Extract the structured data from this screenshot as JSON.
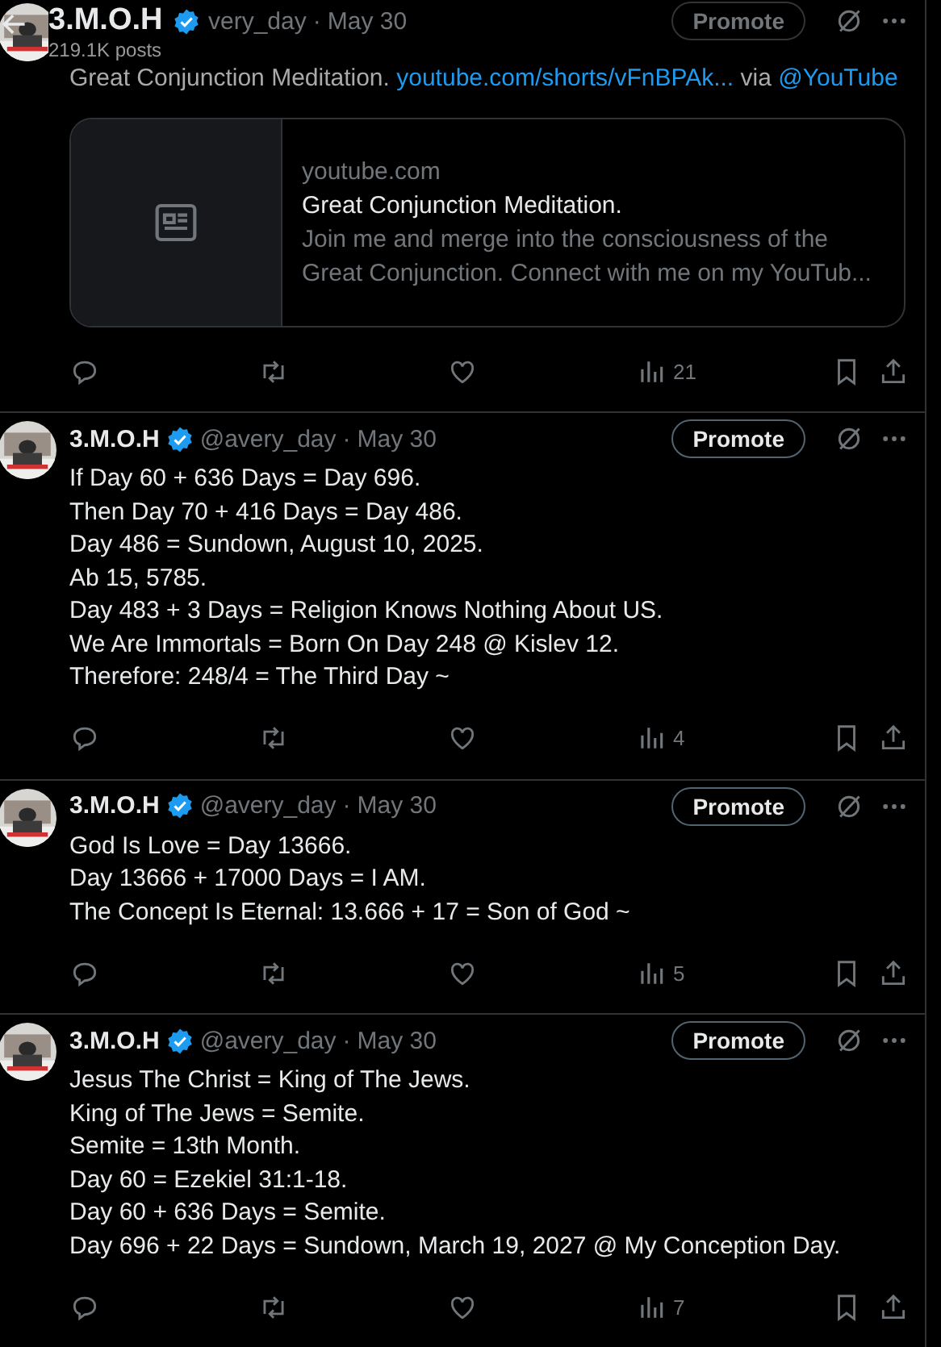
{
  "header": {
    "title": "3.M.O.H",
    "verified": true,
    "subtitle": "219.1K posts"
  },
  "posts": [
    {
      "verified": false,
      "handle": "very_day",
      "separator": "·",
      "date": "May 30",
      "promote": "Promote",
      "parts": [
        {
          "kind": "text",
          "text": "Great Conjunction Meditation. "
        },
        {
          "kind": "link",
          "text": "youtube.com/shorts/vFnBPAk..."
        },
        {
          "kind": "text",
          "text": " via "
        },
        {
          "kind": "link",
          "text": "@YouTube"
        }
      ],
      "card": {
        "domain": "youtube.com",
        "title": "Great Conjunction Meditation.",
        "description": "Join me and merge into the consciousness of the Great Conjunction. Connect with me on my YouTub..."
      },
      "views": "21"
    },
    {
      "name": "3.M.O.H",
      "verified": true,
      "handle": "@avery_day",
      "separator": "·",
      "date": "May 30",
      "promote": "Promote",
      "lines": [
        "If Day 60 + 636 Days = Day 696.",
        "Then Day 70 + 416 Days = Day 486.",
        "Day 486 = Sundown, August 10, 2025.",
        "Ab 15, 5785.",
        "Day 483 + 3 Days = Religion Knows Nothing About US.",
        "We Are Immortals = Born On Day 248 @ Kislev 12.",
        "Therefore: 248/4 = The Third Day ~"
      ],
      "views": "4"
    },
    {
      "name": "3.M.O.H",
      "verified": true,
      "handle": "@avery_day",
      "separator": "·",
      "date": "May 30",
      "promote": "Promote",
      "lines": [
        "God Is Love = Day 13666.",
        "Day 13666 + 17000 Days = I AM.",
        "The Concept Is Eternal: 13.666 + 17 = Son of God ~"
      ],
      "views": "5"
    },
    {
      "name": "3.M.O.H",
      "verified": true,
      "handle": "@avery_day",
      "separator": "·",
      "date": "May 30",
      "promote": "Promote",
      "lines": [
        "Jesus The Christ = King of The Jews.",
        "King of The Jews = Semite.",
        "Semite = 13th Month.",
        "Day 60 = Ezekiel 31:1-18.",
        "Day 60 + 636 Days = Semite.",
        "Day 696 + 22 Days = Sundown, March 19, 2027 @ My Conception Day."
      ],
      "views": "7"
    }
  ]
}
